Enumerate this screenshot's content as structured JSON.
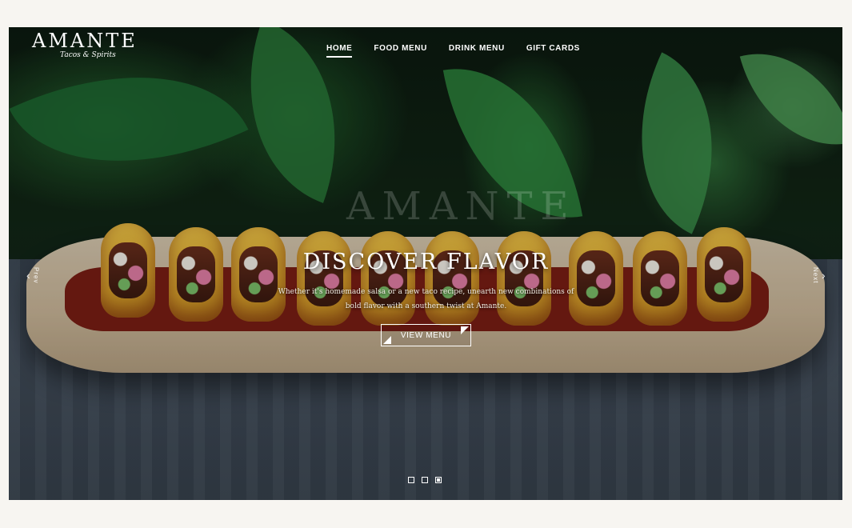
{
  "brand": {
    "name": "AMANTE",
    "tagline": "Tacos & Spirits"
  },
  "nav": {
    "items": [
      {
        "label": "HOME",
        "active": true
      },
      {
        "label": "FOOD MENU",
        "active": false
      },
      {
        "label": "DRINK MENU",
        "active": false
      },
      {
        "label": "GIFT CARDS",
        "active": false
      }
    ]
  },
  "hero": {
    "ghost_text": "AMANTE",
    "headline": "DISCOVER FLAVOR",
    "subtext": "Whether it's homemade salsa or a new taco recipe, unearth new combinations of bold flavor with a southern twist at Amante.",
    "cta_label": "VIEW MENU",
    "prev_label": "Prev",
    "next_label": "Next"
  },
  "carousel": {
    "slides": 3,
    "active_index": 2
  },
  "colors": {
    "page_bg": "#f7f5f1",
    "text": "#ffffff"
  },
  "icons": {
    "prev": "chevron-left-icon",
    "next": "chevron-right-icon"
  }
}
